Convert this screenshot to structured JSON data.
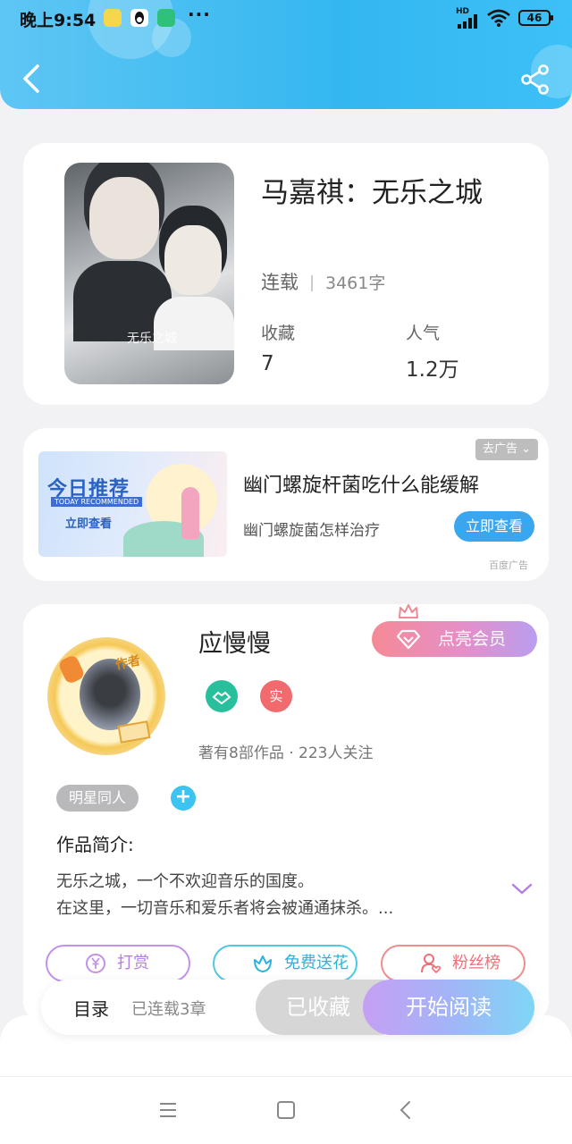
{
  "status_bar": {
    "time": "晚上9:54",
    "more": "···",
    "network": "HD",
    "battery": "46",
    "icons": [
      "app-icon-yellow",
      "qq-icon",
      "security-icon",
      "signal-icon",
      "wifi-icon",
      "battery-icon"
    ]
  },
  "header": {
    "back_icon": "chevron-left-icon",
    "share_icon": "share-icon",
    "gradient": [
      "#5ec6f4",
      "#34b7f0"
    ]
  },
  "book": {
    "title": "马嘉祺：无乐之城",
    "serial_status": "连载",
    "word_count": "3461字",
    "favorites_label": "收藏",
    "favorites_value": "7",
    "popularity_label": "人气",
    "popularity_value": "1.2万",
    "cover_title": "无乐之城"
  },
  "ad": {
    "banner_heading": "今日推荐",
    "banner_sub": "TODAY RECOMMENDED",
    "banner_cta": "立即查看",
    "close_label": "去广告 ⌄",
    "title": "幽门螺旋杆菌吃什么能缓解",
    "description": "幽门螺旋菌怎样治疗",
    "button": "立即查看",
    "source": "百度广告"
  },
  "author": {
    "tag": "作者",
    "name": "应慢慢",
    "vip_button": "点亮会员",
    "badge_real": "实",
    "meta": "著有8部作品 · 223人关注",
    "category_tag": "明星同人",
    "add_tag": "+",
    "intro_heading": "作品简介:",
    "intro_lines": [
      "无乐之城，一个不欢迎音乐的国度。",
      "在这里，一切音乐和爱乐者将会被通通抹杀。..."
    ],
    "actions": {
      "tip": "打赏",
      "flower": "免费送花",
      "fans": "粉丝榜"
    }
  },
  "bottom_bar": {
    "toc_label": "目录",
    "toc_count": "已连载3章",
    "favorited": "已收藏",
    "start_reading": "开始阅读"
  },
  "nav": {
    "icons": [
      "menu-icon",
      "home-square-icon",
      "back-triangle-icon"
    ]
  },
  "colors": {
    "accent": "#3cc3ef",
    "vip_pink": "#f58a96",
    "sign_green": "#27bf9c",
    "real_red": "#f06a6e"
  }
}
